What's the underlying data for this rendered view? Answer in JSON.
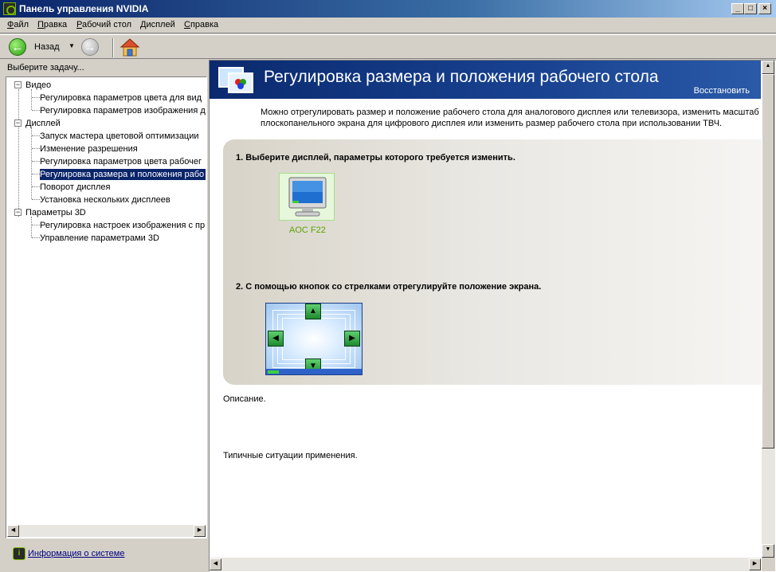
{
  "window": {
    "title": "Панель управления NVIDIA",
    "controls": {
      "minimize": "_",
      "maximize": "□",
      "close": "×"
    }
  },
  "menu": [
    "Файл",
    "Правка",
    "Рабочий стол",
    "Дисплей",
    "Справка"
  ],
  "toolbar": {
    "back_label": "Назад",
    "back_icon": "back-arrow-icon",
    "forward_icon": "forward-arrow-icon",
    "home_icon": "home-icon"
  },
  "sidebar": {
    "header": "Выберите задачу...",
    "tree": [
      {
        "label": "Видео",
        "children": [
          "Регулировка параметров цвета для вид",
          "Регулировка параметров изображения д"
        ]
      },
      {
        "label": "Дисплей",
        "children": [
          "Запуск мастера цветовой оптимизации",
          "Изменение разрешения",
          "Регулировка параметров цвета рабочег",
          "Регулировка размера и положения рабо",
          "Поворот дисплея",
          "Установка нескольких дисплеев"
        ]
      },
      {
        "label": "Параметры 3D",
        "children": [
          "Регулировка настроек изображения с пр",
          "Управление параметрами 3D"
        ]
      }
    ],
    "selected": "Регулировка размера и положения рабо",
    "system_info_link": "Информация о системе"
  },
  "main": {
    "title": "Регулировка размера и положения рабочего стола",
    "restore_link": "Восстановить",
    "intro_line1": "Можно отрегулировать размер и положение рабочего стола для аналогового дисплея или телевизора, изменить масштаб",
    "intro_line2": "плоскопанельного экрана для цифрового дисплея или изменить размер рабочего стола при использовании ТВЧ.",
    "step1": "1. Выберите дисплей, параметры которого требуется изменить.",
    "display_name": "AOC F22",
    "step2": "2. С помощью кнопок со стрелками отрегулируйте положение экрана.",
    "description_label": "Описание.",
    "usage_label": "Типичные ситуации применения."
  },
  "colors": {
    "nvidia_green": "#76b900",
    "banner_blue": "#0b2a6e",
    "selection": "#0a246a"
  }
}
